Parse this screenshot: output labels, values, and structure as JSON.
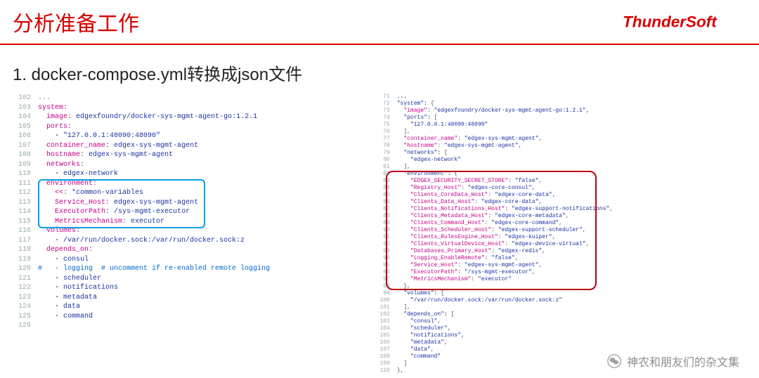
{
  "header": {
    "title": "分析准备工作",
    "logo_text": "ThunderSoft"
  },
  "section": {
    "title": "1. docker-compose.yml转换成json文件"
  },
  "yaml": {
    "lines": [
      {
        "n": 102,
        "t": "..."
      },
      {
        "n": 103,
        "t": "system:",
        "cls": "k"
      },
      {
        "n": 104,
        "t": "  image: edgexfoundry/docker-sys-mgmt-agent-go:1.2.1",
        "key": "image",
        "val": "edgexfoundry/docker-sys-mgmt-agent-go:1.2.1"
      },
      {
        "n": 105,
        "t": "  ports:",
        "key": "ports"
      },
      {
        "n": 106,
        "t": "    - \"127.0.0.1:48090:48090\"",
        "val": "\"127.0.0.1:48090:48090\""
      },
      {
        "n": 107,
        "t": "  container_name: edgex-sys-mgmt-agent",
        "key": "container_name",
        "val": "edgex-sys-mgmt-agent"
      },
      {
        "n": 108,
        "t": "  hostname: edgex-sys-mgmt-agent",
        "key": "hostname",
        "val": "edgex-sys-mgmt-agent"
      },
      {
        "n": 109,
        "t": "  networks:",
        "key": "networks"
      },
      {
        "n": 110,
        "t": "    - edgex-network",
        "val": "edgex-network"
      },
      {
        "n": 111,
        "t": "  environment:",
        "key": "environment"
      },
      {
        "n": 112,
        "t": "    <<: *common-variables",
        "key": "<<",
        "val": "*common-variables"
      },
      {
        "n": 113,
        "t": "    Service_Host: edgex-sys-mgmt-agent",
        "key": "Service_Host",
        "val": "edgex-sys-mgmt-agent"
      },
      {
        "n": 114,
        "t": "    ExecutorPath: /sys-mgmt-executor",
        "key": "ExecutorPath",
        "val": "/sys-mgmt-executor"
      },
      {
        "n": 115,
        "t": "    MetricsMechanism: executor",
        "key": "MetricsMechanism",
        "val": "executor"
      },
      {
        "n": 116,
        "t": "  volumes:",
        "key": "volumes"
      },
      {
        "n": 117,
        "t": "    - /var/run/docker.sock:/var/run/docker.sock:z",
        "val": "/var/run/docker.sock:/var/run/docker.sock:z"
      },
      {
        "n": 118,
        "t": "  depends_on:",
        "key": "depends_on"
      },
      {
        "n": 119,
        "t": "    - consul",
        "val": "consul"
      },
      {
        "n": 120,
        "t": "#   - logging  # uncomment if re-enabled remote logging",
        "comment": true
      },
      {
        "n": 121,
        "t": "    - scheduler",
        "val": "scheduler"
      },
      {
        "n": 122,
        "t": "    - notifications",
        "val": "notifications"
      },
      {
        "n": 123,
        "t": "    - metadata",
        "val": "metadata"
      },
      {
        "n": 124,
        "t": "    - data",
        "val": "data"
      },
      {
        "n": 125,
        "t": "    - command",
        "val": "command"
      },
      {
        "n": 126,
        "t": ""
      }
    ]
  },
  "json": {
    "lines": [
      {
        "n": 71,
        "t": "..."
      },
      {
        "n": 72,
        "t": "\"system\": {"
      },
      {
        "n": 73,
        "t": "  \"image\": \"edgexfoundry/docker-sys-mgmt-agent-go:1.2.1\","
      },
      {
        "n": 74,
        "t": "  \"ports\": ["
      },
      {
        "n": 75,
        "t": "    \"127.0.0.1:48090:48090\""
      },
      {
        "n": 76,
        "t": "  ],"
      },
      {
        "n": 77,
        "t": "  \"container_name\": \"edgex-sys-mgmt-agent\","
      },
      {
        "n": 78,
        "t": "  \"hostname\": \"edgex-sys-mgmt-agent\","
      },
      {
        "n": 79,
        "t": "  \"networks\": ["
      },
      {
        "n": 80,
        "t": "    \"edgex-network\""
      },
      {
        "n": 81,
        "t": "  ],"
      },
      {
        "n": 82,
        "t": "  \"environment\": {"
      },
      {
        "n": 83,
        "t": "    \"EDGEX_SECURITY_SECRET_STORE\": \"false\","
      },
      {
        "n": 84,
        "t": "    \"Registry_Host\": \"edgex-core-consul\","
      },
      {
        "n": 85,
        "t": "    \"Clients_CoreData_Host\": \"edgex-core-data\","
      },
      {
        "n": 86,
        "t": "    \"Clients_Data_Host\": \"edgex-core-data\","
      },
      {
        "n": 87,
        "t": "    \"Clients_Notifications_Host\": \"edgex-support-notifications\","
      },
      {
        "n": 88,
        "t": "    \"Clients_Metadata_Host\": \"edgex-core-metadata\","
      },
      {
        "n": 89,
        "t": "    \"Clients_Command_Host\": \"edgex-core-command\","
      },
      {
        "n": 90,
        "t": "    \"Clients_Scheduler_Host\": \"edgex-support-scheduler\","
      },
      {
        "n": 91,
        "t": "    \"Clients_RulesEngine_Host\": \"edgex-kuiper\","
      },
      {
        "n": 92,
        "t": "    \"Clients_VirtualDevice_Host\": \"edgex-device-virtual\","
      },
      {
        "n": 93,
        "t": "    \"Databases_Primary_Host\": \"edgex-redis\","
      },
      {
        "n": 94,
        "t": "    \"Logging_EnableRemote\": \"false\","
      },
      {
        "n": 95,
        "t": "    \"Service_Host\": \"edgex-sys-mgmt-agent\","
      },
      {
        "n": 96,
        "t": "    \"ExecutorPath\": \"/sys-mgmt-executor\","
      },
      {
        "n": 97,
        "t": "    \"MetricsMechanism\": \"executor\""
      },
      {
        "n": 98,
        "t": "  },"
      },
      {
        "n": 99,
        "t": "  \"volumes\": ["
      },
      {
        "n": 100,
        "t": "    \"/var/run/docker.sock:/var/run/docker.sock:z\""
      },
      {
        "n": 101,
        "t": "  ],"
      },
      {
        "n": 102,
        "t": "  \"depends_on\": ["
      },
      {
        "n": 103,
        "t": "    \"consul\","
      },
      {
        "n": 104,
        "t": "    \"scheduler\","
      },
      {
        "n": 105,
        "t": "    \"notifications\","
      },
      {
        "n": 106,
        "t": "    \"metadata\","
      },
      {
        "n": 107,
        "t": "    \"data\","
      },
      {
        "n": 108,
        "t": "    \"command\""
      },
      {
        "n": 109,
        "t": "  ]"
      },
      {
        "n": 110,
        "t": "},"
      }
    ]
  },
  "watermark": {
    "text": "神农和朋友们的杂文集"
  }
}
